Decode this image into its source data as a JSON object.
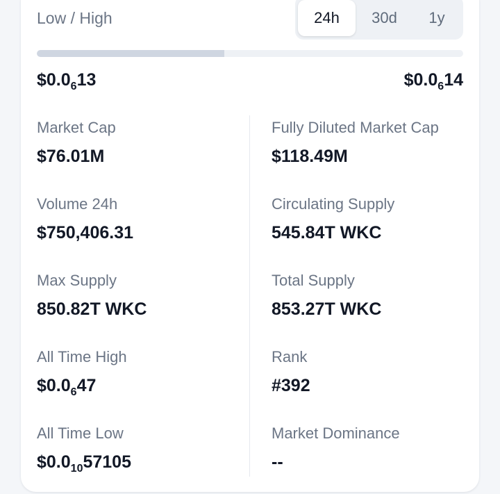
{
  "range": {
    "label": "Low / High",
    "tabs": [
      "24h",
      "30d",
      "1y"
    ],
    "active_tab": "24h",
    "position_fraction": 0.44,
    "low": {
      "prefix": "$0.0",
      "zeros": "6",
      "digits": "13"
    },
    "high": {
      "prefix": "$0.0",
      "zeros": "6",
      "digits": "14"
    }
  },
  "stats": {
    "market_cap": {
      "label": "Market Cap",
      "value": "$76.01M"
    },
    "fdv": {
      "label": "Fully Diluted Market Cap",
      "value": "$118.49M"
    },
    "volume": {
      "label": "Volume 24h",
      "value": "$750,406.31"
    },
    "circulating": {
      "label": "Circulating Supply",
      "value": "545.84T WKC"
    },
    "max_supply": {
      "label": "Max Supply",
      "value": "850.82T WKC"
    },
    "total_supply": {
      "label": "Total Supply",
      "value": "853.27T WKC"
    },
    "ath": {
      "label": "All Time High",
      "prefix": "$0.0",
      "zeros": "6",
      "digits": "47"
    },
    "rank": {
      "label": "Rank",
      "value": "#392"
    },
    "atl": {
      "label": "All Time Low",
      "prefix": "$0.0",
      "zeros": "10",
      "digits": "57105"
    },
    "dominance": {
      "label": "Market Dominance",
      "value": "--"
    }
  },
  "colors": {
    "card": "#ffffff",
    "background": "#f4f6f9",
    "muted_text": "#6b7585",
    "strong_text": "#121826",
    "range_fill": "#cfd6e1"
  }
}
